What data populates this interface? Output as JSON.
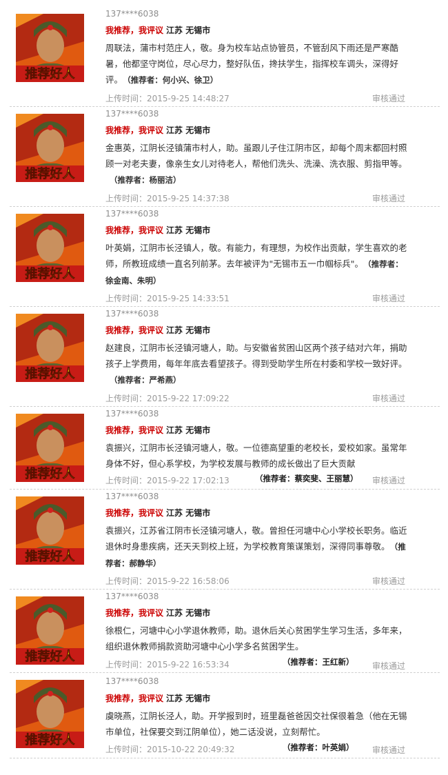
{
  "avatar_text": "推荐好人",
  "items": [
    {
      "phone": "137****6038",
      "headline": "我推荐，我评议",
      "region": "江苏 无锡市",
      "body": "周联法，蒲市村范庄人，敬。身为校车站点协管员，不管刮风下雨还是严寒酷暑，他都坚守岗位，尽心尽力，整好队伍，搀扶学生，指挥校车调头，深得好评。",
      "recommender": "（推荐者：何小兴、徐卫）",
      "time": "上传时间：2015-9-25 14:48:27",
      "status": "审核通过"
    },
    {
      "phone": "137****6038",
      "headline": "我推荐，我评议",
      "region": "江苏 无锡市",
      "body": "金惠英，江阴长泾镇蒲市村人，助。虽跟儿子住江阴市区，却每个周末都回村照顾一对老夫妻，像亲生女儿对待老人，帮他们洗头、洗澡、洗衣服、剪指甲等。",
      "recommender": "（推荐者：杨丽洁）",
      "time": "上传时间：2015-9-25 14:37:38",
      "status": "审核通过"
    },
    {
      "phone": "137****6038",
      "headline": "我推荐，我评议",
      "region": "江苏 无锡市",
      "body": "叶英娟，江阴市长泾镇人，敬。有能力，有理想，为校作出贡献，学生喜欢的老师，所教班成绩一直名列前茅。去年被评为\"无锡市五一巾帼标兵\"。",
      "recommender": "（推荐者：徐金南、朱明）",
      "time": "上传时间：2015-9-25 14:33:51",
      "status": "审核通过"
    },
    {
      "phone": "137****6038",
      "headline": "我推荐，我评议",
      "region": "江苏 无锡市",
      "body": "赵建良，江阴市长泾镇河塘人，助。与安徽省贫困山区两个孩子结对六年，捐助孩子上学费用，每年年底去看望孩子。得到受助学生所在村委和学校一致好评。",
      "recommender": "（推荐者：严希燕）",
      "time": "上传时间：2015-9-22 17:09:22",
      "status": "审核通过"
    },
    {
      "phone": "137****6038",
      "headline": "我推荐，我评议",
      "region": "江苏 无锡市",
      "body": "袁振兴，江阴市长泾镇河塘人，敬。一位德高望重的老校长，爱校如家。虽常年身体不好，但心系学校，为学校发展与教师的成长做出了巨大贡献",
      "recommender": "（推荐者：蔡奕斐、王丽慧）",
      "time": "上传时间：2015-9-22 17:02:13",
      "status": "审核通过"
    },
    {
      "phone": "137****6038",
      "headline": "我推荐，我评议",
      "region": "江苏 无锡市",
      "body": "袁振兴，江苏省江阴市长泾镇河塘人，敬。曾担任河塘中心小学校长职务。临近退休时身患疾病，还天天到校上班，为学校教育策谋策划，深得同事尊敬。",
      "recommender": "（推荐者：郝静华）",
      "time": "上传时间：2015-9-22 16:58:06",
      "status": "审核通过"
    },
    {
      "phone": "137****6038",
      "headline": "我推荐，我评议",
      "region": "江苏 无锡市",
      "body": "徐根仁，河塘中心小学退休教师，助。退休后关心贫困学生学习生活，多年来，组织退休教师捐款资助河塘中心小学多名贫困学生。",
      "recommender": "（推荐者：王红新）",
      "time": "上传时间：2015-9-22 16:53:34",
      "status": "审核通过"
    },
    {
      "phone": "137****6038",
      "headline": "我推荐，我评议",
      "region": "江苏 无锡市",
      "body": "虞晓燕，江阴长泾人，助。开学报到时，班里磊爸爸因交社保很着急（他在无锡市单位，社保要交到江阴单位），她二话没说，立刻帮忙。",
      "recommender": "（推荐者：叶英娟）",
      "time": "上传时间：2015-10-22 20:49:32",
      "status": "审核通过"
    }
  ]
}
